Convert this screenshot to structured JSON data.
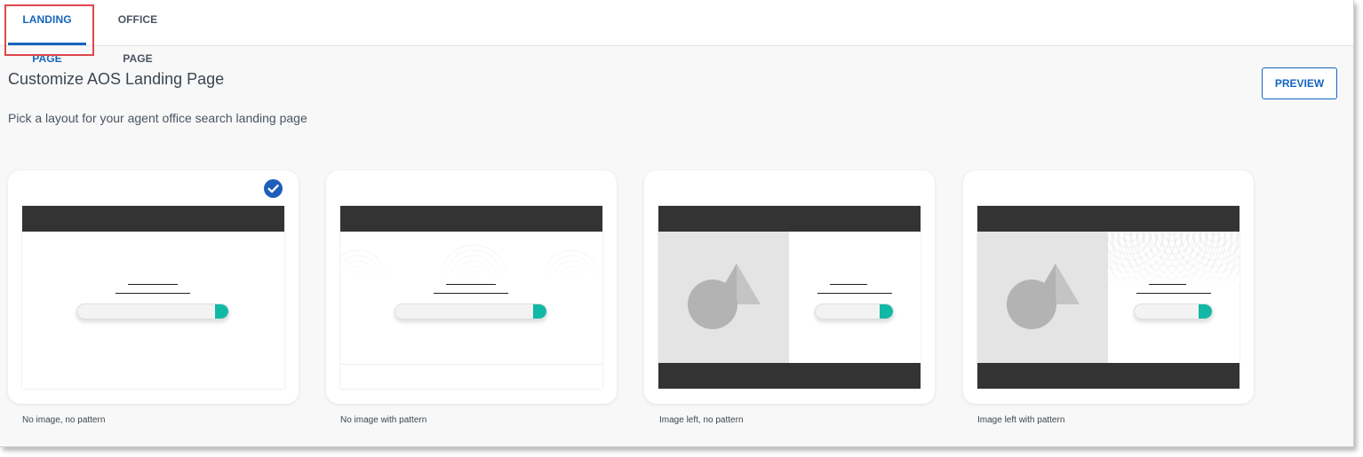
{
  "tabs": {
    "landing": "LANDING PAGE",
    "office": "OFFICE PAGE",
    "active": "landing"
  },
  "header": {
    "title": "Customize AOS Landing Page",
    "subtitle": "Pick a layout for your agent office search landing page",
    "preview_label": "PREVIEW"
  },
  "layouts": [
    {
      "caption": "No image, no pattern",
      "selected": true
    },
    {
      "caption": "No image with pattern",
      "selected": false
    },
    {
      "caption": "Image left, no pattern",
      "selected": false
    },
    {
      "caption": "Image left with pattern",
      "selected": false
    }
  ],
  "colors": {
    "accent": "#1565c0",
    "highlight_box": "#e0474c",
    "selected_check": "#1e5ebb",
    "search_button": "#12b8a6",
    "preview_bar": "#333333"
  },
  "icons": {
    "selected": "check-circle-icon",
    "image_placeholder": "shapes-placeholder-icon"
  }
}
